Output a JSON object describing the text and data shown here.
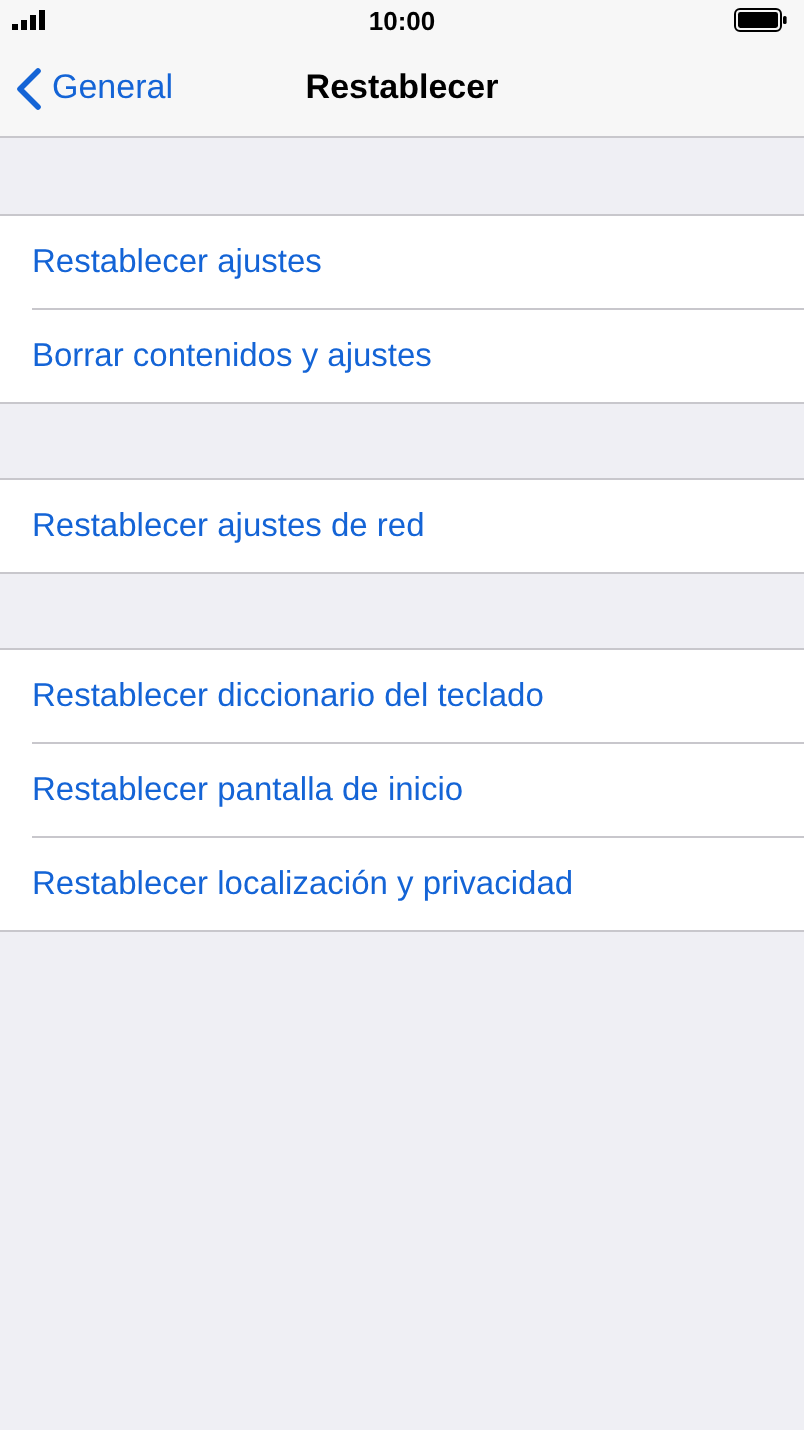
{
  "status_bar": {
    "time": "10:00"
  },
  "nav": {
    "back": "General",
    "title": "Restablecer"
  },
  "groups": [
    {
      "items": [
        "Restablecer ajustes",
        "Borrar contenidos y ajustes"
      ]
    },
    {
      "items": [
        "Restablecer ajustes de red"
      ]
    },
    {
      "items": [
        "Restablecer diccionario del teclado",
        "Restablecer pantalla de inicio",
        "Restablecer localización y privacidad"
      ]
    }
  ]
}
